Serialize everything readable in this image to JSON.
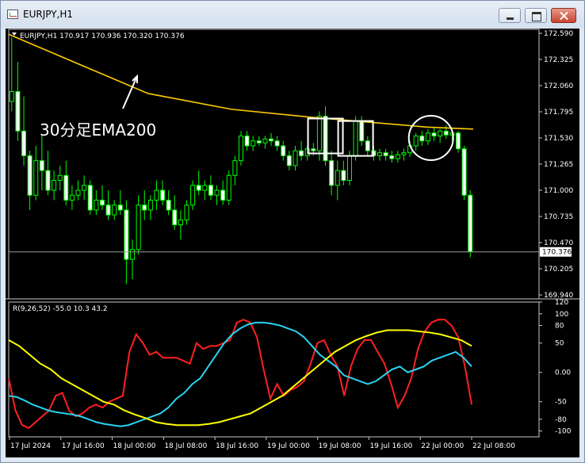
{
  "window": {
    "title": "EURJPY,H1"
  },
  "chart_data": [
    {
      "type": "candlestick",
      "header": "EURJPY,H1  170.917 170.936 170.320 170.376",
      "symbol": "EURJPY",
      "timeframe": "H1",
      "ohlc": {
        "open": 170.917,
        "high": 170.936,
        "low": 170.32,
        "close": 170.376
      },
      "current_price_label": "170.376",
      "ylim": [
        169.94,
        172.59
      ],
      "yticks": [
        "172.590",
        "172.325",
        "172.060",
        "171.795",
        "171.530",
        "171.265",
        "171.000",
        "170.735",
        "170.470",
        "170.205",
        "169.940"
      ],
      "candle_color": "#00ff00",
      "candles": [
        [
          171.9,
          172.55,
          171.8,
          172.0
        ],
        [
          172.0,
          172.3,
          171.5,
          171.6
        ],
        [
          171.6,
          171.95,
          171.25,
          171.35
        ],
        [
          171.35,
          171.4,
          170.8,
          170.95
        ],
        [
          170.95,
          171.45,
          170.9,
          171.3
        ],
        [
          171.3,
          171.55,
          171.0,
          171.2
        ],
        [
          171.2,
          171.4,
          170.95,
          171.0
        ],
        [
          171.0,
          171.2,
          170.9,
          171.1
        ],
        [
          171.1,
          171.25,
          171.0,
          171.15
        ],
        [
          171.15,
          171.3,
          170.85,
          170.9
        ],
        [
          170.9,
          171.05,
          170.8,
          170.95
        ],
        [
          170.95,
          171.1,
          170.9,
          171.0
        ],
        [
          171.0,
          171.15,
          170.9,
          171.05
        ],
        [
          171.05,
          171.1,
          170.75,
          170.8
        ],
        [
          170.8,
          171.0,
          170.75,
          170.9
        ],
        [
          170.9,
          171.05,
          170.8,
          170.85
        ],
        [
          170.85,
          171.0,
          170.7,
          170.75
        ],
        [
          170.75,
          170.9,
          170.7,
          170.85
        ],
        [
          170.85,
          171.0,
          170.75,
          170.8
        ],
        [
          170.8,
          170.9,
          170.05,
          170.3
        ],
        [
          170.3,
          170.5,
          170.1,
          170.4
        ],
        [
          170.4,
          170.95,
          170.35,
          170.85
        ],
        [
          170.85,
          171.0,
          170.7,
          170.8
        ],
        [
          170.8,
          170.95,
          170.7,
          170.9
        ],
        [
          170.9,
          171.1,
          170.8,
          171.0
        ],
        [
          171.0,
          171.1,
          170.85,
          170.9
        ],
        [
          170.9,
          171.0,
          170.75,
          170.8
        ],
        [
          170.8,
          170.95,
          170.6,
          170.65
        ],
        [
          170.65,
          170.8,
          170.5,
          170.7
        ],
        [
          170.7,
          170.9,
          170.65,
          170.85
        ],
        [
          170.85,
          171.1,
          170.8,
          171.05
        ],
        [
          171.05,
          171.2,
          170.95,
          171.0
        ],
        [
          171.0,
          171.1,
          170.9,
          171.05
        ],
        [
          171.05,
          171.15,
          170.9,
          170.95
        ],
        [
          170.95,
          171.05,
          170.85,
          171.0
        ],
        [
          171.0,
          171.1,
          170.85,
          170.9
        ],
        [
          170.9,
          171.2,
          170.85,
          171.15
        ],
        [
          171.15,
          171.35,
          171.05,
          171.3
        ],
        [
          171.3,
          171.6,
          171.25,
          171.55
        ],
        [
          171.55,
          171.6,
          171.4,
          171.45
        ],
        [
          171.45,
          171.55,
          171.4,
          171.5
        ],
        [
          171.5,
          171.55,
          171.45,
          171.48
        ],
        [
          171.48,
          171.55,
          171.42,
          171.52
        ],
        [
          171.52,
          171.58,
          171.45,
          171.5
        ],
        [
          171.5,
          171.55,
          171.4,
          171.45
        ],
        [
          171.45,
          171.5,
          171.3,
          171.35
        ],
        [
          171.35,
          171.4,
          171.2,
          171.25
        ],
        [
          171.25,
          171.45,
          171.2,
          171.4
        ],
        [
          171.4,
          171.5,
          171.3,
          171.35
        ],
        [
          171.35,
          171.45,
          171.3,
          171.42
        ],
        [
          171.42,
          171.48,
          171.35,
          171.4
        ],
        [
          171.4,
          171.8,
          171.3,
          171.75
        ],
        [
          171.75,
          171.85,
          171.25,
          171.3
        ],
        [
          171.3,
          171.4,
          170.95,
          171.05
        ],
        [
          171.05,
          171.3,
          170.9,
          171.2
        ],
        [
          171.2,
          171.3,
          171.05,
          171.1
        ],
        [
          171.1,
          171.4,
          171.05,
          171.35
        ],
        [
          171.35,
          171.75,
          171.3,
          171.7
        ],
        [
          171.7,
          171.75,
          171.45,
          171.5
        ],
        [
          171.5,
          171.55,
          171.35,
          171.4
        ],
        [
          171.4,
          171.45,
          171.3,
          171.35
        ],
        [
          171.35,
          171.42,
          171.3,
          171.38
        ],
        [
          171.38,
          171.42,
          171.3,
          171.35
        ],
        [
          171.35,
          171.4,
          171.28,
          171.32
        ],
        [
          171.32,
          171.4,
          171.28,
          171.36
        ],
        [
          171.36,
          171.42,
          171.3,
          171.38
        ],
        [
          171.38,
          171.5,
          171.34,
          171.45
        ],
        [
          171.45,
          171.58,
          171.4,
          171.55
        ],
        [
          171.55,
          171.6,
          171.45,
          171.5
        ],
        [
          171.5,
          171.62,
          171.46,
          171.58
        ],
        [
          171.58,
          171.64,
          171.5,
          171.55
        ],
        [
          171.55,
          171.62,
          171.48,
          171.6
        ],
        [
          171.6,
          171.66,
          171.52,
          171.56
        ],
        [
          171.56,
          171.62,
          171.5,
          171.58
        ],
        [
          171.58,
          171.6,
          171.38,
          171.42
        ],
        [
          171.42,
          171.45,
          170.9,
          170.95
        ],
        [
          170.95,
          171.0,
          170.32,
          170.38
        ]
      ],
      "ema": {
        "label": "30分足EMA200",
        "color": "#ffcc00",
        "x_frac": [
          0.0,
          0.15,
          0.3,
          0.48,
          0.65,
          0.8,
          0.9,
          1.0
        ],
        "y": [
          172.58,
          172.28,
          171.98,
          171.82,
          171.74,
          171.68,
          171.64,
          171.62
        ]
      },
      "marked_candle_indices": [
        52,
        57
      ],
      "circled_candle_range": [
        67,
        72
      ]
    },
    {
      "type": "line",
      "header": "R(9,26,52) -55.0 10.3 43.2",
      "ylim": [
        -110,
        120
      ],
      "yticks": [
        "120",
        "100",
        "80",
        "50",
        "0.00",
        "-50",
        "-80",
        "-100"
      ],
      "ytick_values": [
        120,
        100,
        80,
        50,
        0,
        -50,
        -80,
        -100
      ],
      "series": [
        {
          "color": "#ff2020",
          "values": [
            -10,
            -65,
            -90,
            -95,
            -85,
            -75,
            -65,
            -40,
            -35,
            -65,
            -75,
            -70,
            -60,
            -55,
            -60,
            -50,
            -45,
            -40,
            35,
            65,
            50,
            30,
            35,
            25,
            25,
            25,
            20,
            15,
            50,
            40,
            45,
            45,
            50,
            55,
            85,
            90,
            85,
            60,
            5,
            -45,
            -20,
            -40,
            -30,
            -25,
            -15,
            15,
            50,
            55,
            30,
            10,
            -40,
            10,
            40,
            55,
            55,
            35,
            15,
            -20,
            -60,
            -40,
            -10,
            40,
            70,
            85,
            90,
            90,
            80,
            60,
            10,
            -55
          ]
        },
        {
          "color": "#29d3f0",
          "values": [
            -40,
            -42,
            -48,
            -55,
            -60,
            -65,
            -68,
            -70,
            -72,
            -75,
            -80,
            -85,
            -88,
            -90,
            -92,
            -90,
            -85,
            -80,
            -75,
            -70,
            -60,
            -45,
            -35,
            -20,
            -10,
            10,
            30,
            50,
            65,
            75,
            82,
            85,
            85,
            83,
            80,
            75,
            70,
            60,
            45,
            30,
            20,
            10,
            -5,
            -10,
            -15,
            -20,
            -15,
            -5,
            5,
            10,
            0,
            5,
            10,
            20,
            25,
            30,
            35,
            25,
            10
          ]
        },
        {
          "color": "#ffff00",
          "values": [
            55,
            45,
            30,
            15,
            5,
            -10,
            -20,
            -30,
            -40,
            -50,
            -55,
            -65,
            -72,
            -78,
            -85,
            -88,
            -90,
            -90,
            -90,
            -88,
            -85,
            -80,
            -75,
            -70,
            -60,
            -50,
            -40,
            -25,
            -10,
            5,
            20,
            35,
            45,
            55,
            62,
            68,
            72,
            72,
            72,
            70,
            68,
            65,
            60,
            55,
            45
          ]
        }
      ],
      "x_tick_labels": [
        "17 Jul 2024",
        "17 Jul 16:00",
        "18 Jul 00:00",
        "18 Jul 08:00",
        "18 Jul 16:00",
        "19 Jul 00:00",
        "19 Jul 08:00",
        "19 Jul 16:00",
        "22 Jul 00:00",
        "22 Jul 08:00"
      ]
    }
  ]
}
